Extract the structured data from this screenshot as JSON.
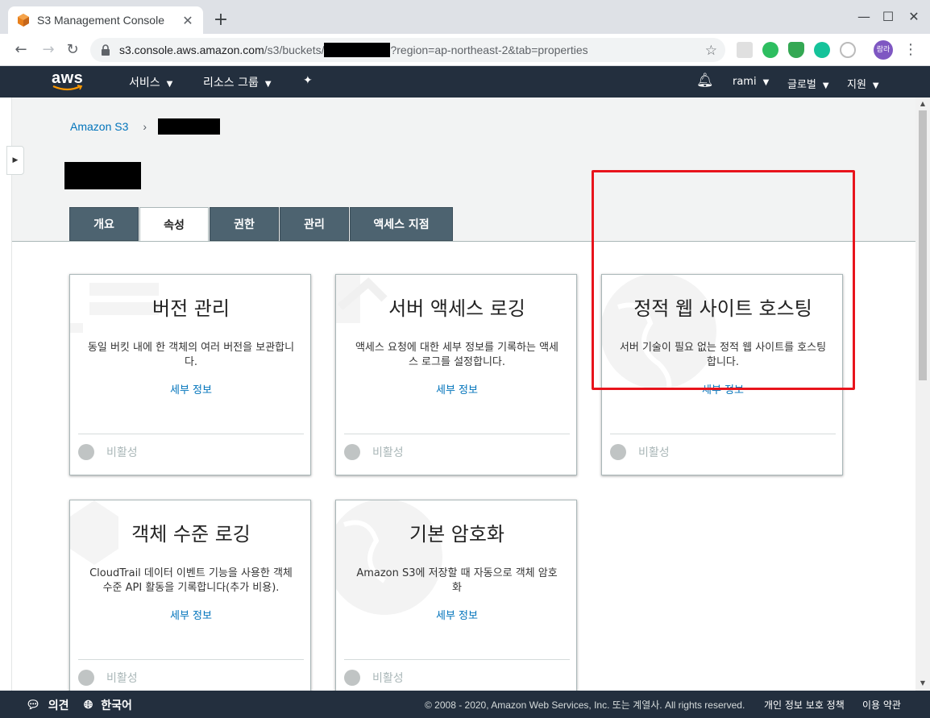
{
  "browser": {
    "tab_title": "S3 Management Console",
    "url_prefix": "s3.console.aws.amazon.com",
    "url_path": "/s3/buckets/",
    "url_query": "?region=ap-northeast-2&tab=properties",
    "avatar_label": "람라"
  },
  "aws_nav": {
    "logo": "aws",
    "services": "서비스",
    "resource_groups": "리소스 그룹",
    "user": "rami",
    "region": "글로벌",
    "support": "지원"
  },
  "breadcrumb": {
    "root": "Amazon S3"
  },
  "tabs": [
    "개요",
    "속성",
    "권한",
    "관리",
    "액세스 지점"
  ],
  "cards": [
    {
      "title": "버전 관리",
      "description": "동일 버킷 내에 한 객체의 여러 버전을 보관합니다.",
      "link": "세부 정보",
      "status": "비활성"
    },
    {
      "title": "서버 액세스 로깅",
      "description": "액세스 요청에 대한 세부 정보를 기록하는 액세스 로그를 설정합니다.",
      "link": "세부 정보",
      "status": "비활성"
    },
    {
      "title": "정적 웹 사이트 호스팅",
      "description": "서버 기술이 필요 없는 정적 웹 사이트를 호스팅합니다.",
      "link": "세부 정보",
      "status": "비활성"
    },
    {
      "title": "객체 수준 로깅",
      "description": "CloudTrail 데이터 이벤트 기능을 사용한 객체 수준 API 활동을 기록합니다(추가 비용).",
      "link": "세부 정보",
      "status": "비활성"
    },
    {
      "title": "기본 암호화",
      "description": "Amazon S3에 저장할 때 자동으로 객체 암호화",
      "link": "세부 정보",
      "status": "비활성"
    }
  ],
  "footer": {
    "feedback": "의견",
    "language": "한국어",
    "copyright": "© 2008 - 2020, Amazon Web Services, Inc. 또는 계열사. All rights reserved.",
    "privacy": "개인 정보 보호 정책",
    "terms": "이용 약관"
  },
  "colors": {
    "aws_nav_bg": "#232f3e",
    "tab_bg": "#4d6370",
    "link": "#0073bb",
    "highlight": "#e8141c"
  }
}
